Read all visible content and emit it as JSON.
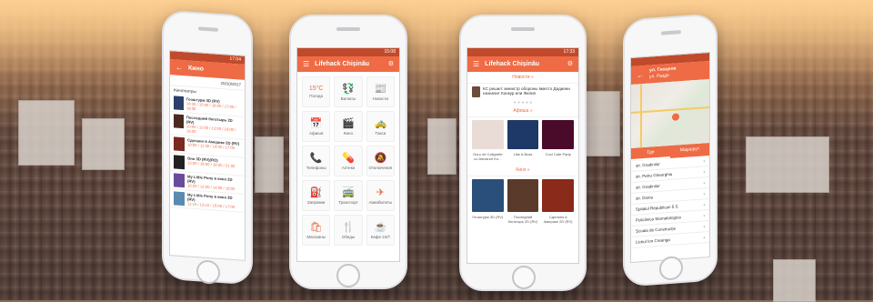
{
  "phone1": {
    "status": "17:04",
    "title": "Кино",
    "date": "20/10/2017",
    "section": "Кинотеатры",
    "movies": [
      {
        "title": "Геоштурм 3D (RV)",
        "times": "19:30 / 15:00 / 16:00 / 17:00 / 18:00"
      },
      {
        "title": "Последний богатырь 2D (RV)",
        "times": "10:00 / 11:00 / 13:00 / 16:00 / 18:00"
      },
      {
        "title": "Сделано в Америке 2D (RV)",
        "times": "10:00 / 11:30 / 14:00 / 17:00"
      },
      {
        "title": "Оно 3D (RV)(RO)",
        "times": "13:00 / 16:00 / 18:00 / 21:00"
      },
      {
        "title": "My Little Pony в кино 2D (RV)",
        "times": "10:20 / 12:00 / 14:00 / 16:00"
      },
      {
        "title": "My Little Pony в кино 3D (RV)",
        "times": "11:10 / 13:10 / 15:00 / 17:00"
      }
    ]
  },
  "phone2": {
    "status": "15:08",
    "title": "Lifehack Chișinău",
    "tiles": [
      {
        "icon": "15°C",
        "label": "Погода"
      },
      {
        "icon": "💱",
        "label": "Валюты"
      },
      {
        "icon": "📰",
        "label": "Новости"
      },
      {
        "icon": "📅",
        "label": "Афиша"
      },
      {
        "icon": "🎬",
        "label": "Кино"
      },
      {
        "icon": "🚕",
        "label": "Такси"
      },
      {
        "icon": "📞",
        "label": "Телефоны"
      },
      {
        "icon": "💊",
        "label": "Аптеки"
      },
      {
        "icon": "🔕",
        "label": "Отключения"
      },
      {
        "icon": "⛽",
        "label": "Заправки"
      },
      {
        "icon": "🚎",
        "label": "Транспорт"
      },
      {
        "icon": "✈",
        "label": "Авиабилеты"
      },
      {
        "icon": "🛍",
        "label": "Магазины"
      },
      {
        "icon": "🍴",
        "label": "Обеды"
      },
      {
        "icon": "☕",
        "label": "Кафе 24/7"
      }
    ]
  },
  "phone3": {
    "status": "17:33",
    "title": "Lifehack Chișinău",
    "news_header": "Новости »",
    "news_item": "КС решил: министр обороны вместо Дадиани назначит Конкур или Филип",
    "events_header": "Афиша »",
    "events": [
      "Guro de Caligrafie cu Alexandr Ko...",
      "Like A Boss",
      "Cool Cafe Party"
    ],
    "cinema_header": "Кино »",
    "films": [
      "Геоштурм 3D (RV)",
      "Последний богатырь 2D (RV)",
      "Сделано в Америке 2D (RV)"
    ]
  },
  "phone4": {
    "title": "ул. Гиоцеля",
    "subtitle": "ул. Разде",
    "tab_left": "Где",
    "tab_right": "Маршрут",
    "stops": [
      "str. Gradinilor",
      "str. Petru Gheorghiu",
      "str. Gradinilor",
      "str. Doina",
      "Spitalul Republican 5 S",
      "Policlinica Stomatologica",
      "Școala de Construcție",
      "Liceul Ion Creanga"
    ]
  },
  "colors": {
    "accent": "#ee6b45",
    "statusbar": "#c04a2b"
  }
}
